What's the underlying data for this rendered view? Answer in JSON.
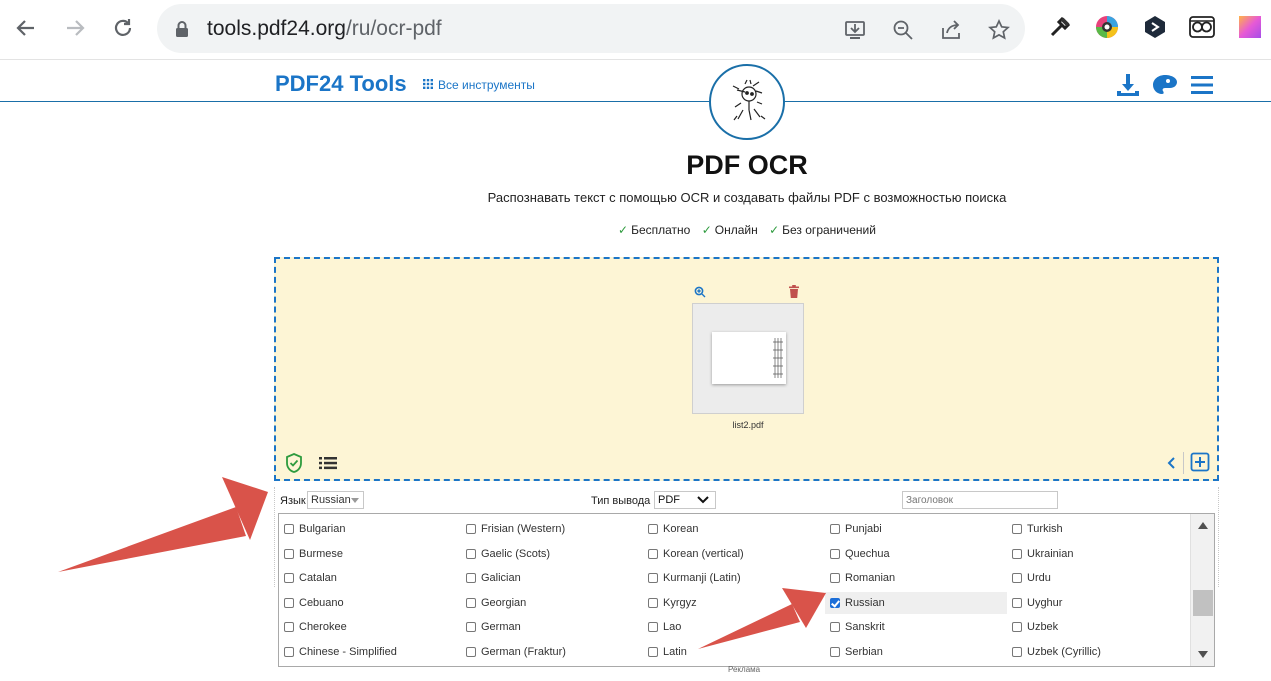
{
  "browser": {
    "url_host": "tools.pdf24.org",
    "url_path": "/ru/ocr-pdf",
    "icons": [
      "back-icon",
      "forward-icon",
      "reload-icon",
      "lock-icon",
      "install-app-icon",
      "zoom-out-icon",
      "share-icon",
      "bookmark-star-icon"
    ],
    "extensions": [
      "eyedropper-icon",
      "color-picker-icon",
      "extension-shield-icon",
      "owl-icon",
      "gradient-icon"
    ]
  },
  "header": {
    "brand": "PDF24 Tools",
    "all_tools": "Все инструменты",
    "icons": [
      "download-icon",
      "theme-palette-icon",
      "menu-icon"
    ]
  },
  "main": {
    "title": "PDF OCR",
    "subtitle": "Распознавать текст с помощью OCR и создавать файлы PDF с возможностью поиска",
    "features": [
      "Бесплатно",
      "Онлайн",
      "Без ограничений"
    ]
  },
  "dropzone": {
    "file_name": "list2.pdf",
    "accent": "#1b75c7",
    "background": "#fdf5d5"
  },
  "options": {
    "language_label": "Язык",
    "language_value": "Russian",
    "output_label": "Тип вывода",
    "output_value": "PDF",
    "title_placeholder": "Заголовок"
  },
  "languages": {
    "columns": [
      [
        {
          "label": "Bulgarian",
          "checked": false
        },
        {
          "label": "Burmese",
          "checked": false
        },
        {
          "label": "Catalan",
          "checked": false
        },
        {
          "label": "Cebuano",
          "checked": false
        },
        {
          "label": "Cherokee",
          "checked": false
        },
        {
          "label": "Chinese - Simplified",
          "checked": false
        }
      ],
      [
        {
          "label": "Frisian (Western)",
          "checked": false
        },
        {
          "label": "Gaelic (Scots)",
          "checked": false
        },
        {
          "label": "Galician",
          "checked": false
        },
        {
          "label": "Georgian",
          "checked": false
        },
        {
          "label": "German",
          "checked": false
        },
        {
          "label": "German (Fraktur)",
          "checked": false
        }
      ],
      [
        {
          "label": "Korean",
          "checked": false
        },
        {
          "label": "Korean (vertical)",
          "checked": false
        },
        {
          "label": "Kurmanji (Latin)",
          "checked": false
        },
        {
          "label": "Kyrgyz",
          "checked": false
        },
        {
          "label": "Lao",
          "checked": false
        },
        {
          "label": "Latin",
          "checked": false
        }
      ],
      [
        {
          "label": "Punjabi",
          "checked": false
        },
        {
          "label": "Quechua",
          "checked": false
        },
        {
          "label": "Romanian",
          "checked": false
        },
        {
          "label": "Russian",
          "checked": true
        },
        {
          "label": "Sanskrit",
          "checked": false
        },
        {
          "label": "Serbian",
          "checked": false
        }
      ],
      [
        {
          "label": "Turkish",
          "checked": false
        },
        {
          "label": "Ukrainian",
          "checked": false
        },
        {
          "label": "Urdu",
          "checked": false
        },
        {
          "label": "Uyghur",
          "checked": false
        },
        {
          "label": "Uzbek",
          "checked": false
        },
        {
          "label": "Uzbek (Cyrillic)",
          "checked": false
        }
      ]
    ]
  },
  "ad_label": "Реклама",
  "annotation_color": "#d9534a"
}
